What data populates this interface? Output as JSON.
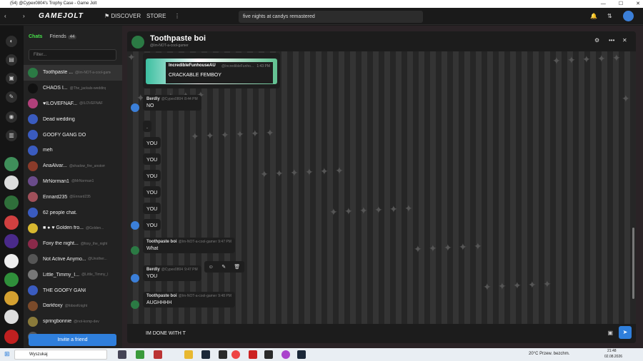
{
  "window": {
    "title": "(54) @Cypex0804's Trophy Case - Game Jolt"
  },
  "topbar": {
    "logo": "GAMEJOLT",
    "discover": "DISCOVER",
    "store": "STORE",
    "search_value": "five nights at candys remastered"
  },
  "sidebar": {
    "tab_chats": "Chats",
    "tab_friends": "Friends",
    "friends_count": "44",
    "filter_placeholder": "Filter...",
    "chats": [
      {
        "name": "Toothpaste ...",
        "user": "@Im-NOT-a-cool-gamer",
        "color": "#2b7a44"
      },
      {
        "name": "CHAOS I...",
        "user": "@The_jackals-wedding",
        "color": "#111"
      },
      {
        "name": "♥ILOVEFNAF...",
        "user": "@ILOVEFNAF",
        "color": "#b0407a"
      },
      {
        "name": "Dead wedding",
        "user": "",
        "color": "#3a5bbf"
      },
      {
        "name": "GOOFY GANG DON'T INVIT...",
        "user": "",
        "color": "#3a5bbf"
      },
      {
        "name": "meh",
        "user": "",
        "color": "#3a5bbf"
      },
      {
        "name": "AnaAlvar...",
        "user": "@shadow_fire_anstom",
        "color": "#8a3b2a"
      },
      {
        "name": "MrNorman1",
        "user": "@MrNorman1",
        "color": "#6a4b8a"
      },
      {
        "name": "Ennard235",
        "user": "@Ennard235",
        "color": "#a0505a"
      },
      {
        "name": "62 people chat.",
        "user": "",
        "color": "#3a5bbf"
      },
      {
        "name": "■ ● ♥ Golden fro...",
        "user": "@Golden...",
        "color": "#d8b830"
      },
      {
        "name": "Foxy the night...",
        "user": "@foxy_the_night",
        "color": "#8a2a4a"
      },
      {
        "name": "Not Active Anymo...",
        "user": "@Unother...",
        "color": "#555"
      },
      {
        "name": "Little_Timmy_I...",
        "user": "@Little_Timmy_I",
        "color": "#777"
      },
      {
        "name": "THE GOOFY GANG",
        "user": "",
        "color": "#3a5bbf"
      },
      {
        "name": "Darkfoxy",
        "user": "@foboxKnight",
        "color": "#7a4a2a"
      },
      {
        "name": "springbonnie",
        "user": "@not-komp-dev",
        "color": "#8a7a3a"
      },
      {
        "name": "...",
        "user": "",
        "color": "#555"
      }
    ],
    "invite_label": "Invite a friend"
  },
  "chat": {
    "title": "Toothpaste boi",
    "username": "@Im-NOT-a-cool-gamer",
    "embed": {
      "author": "IncredibleFunhouseAU",
      "handle": "@IncredibleFunho...",
      "time": "1:43 PM",
      "text": "CRACKABLE FEMBOY"
    },
    "messages": [
      {
        "author": "Berdly",
        "handle": "@Cypex0804",
        "time": "8:44 PM",
        "text": "NO"
      },
      {
        "text": "."
      },
      {
        "text": "YOU"
      },
      {
        "text": "YOU"
      },
      {
        "text": "YOU"
      },
      {
        "text": "YOU"
      },
      {
        "text": "YOU"
      },
      {
        "text": "YOU"
      },
      {
        "author": "Toothpaste boi",
        "handle": "@Im-NOT-a-cool-gamer",
        "time": "9:47 PM",
        "text": "What"
      },
      {
        "author": "Berdly",
        "handle": "@Cypex0804",
        "time": "9:47 PM",
        "text": "YOU"
      },
      {
        "author": "Toothpaste boi",
        "handle": "@Im-NOT-a-cool-gamer",
        "time": "9:48 PM",
        "text": "AUGHHHH"
      }
    ],
    "composer_value": "IM DONE WITH T"
  },
  "taskbar": {
    "search_label": "Wyszukaj",
    "weather": "20°C  Przew. bezchm.",
    "time": "21:48",
    "date": "02.08.2026"
  },
  "colors": {
    "accent": "#47e04a",
    "button": "#2f7fdc"
  }
}
